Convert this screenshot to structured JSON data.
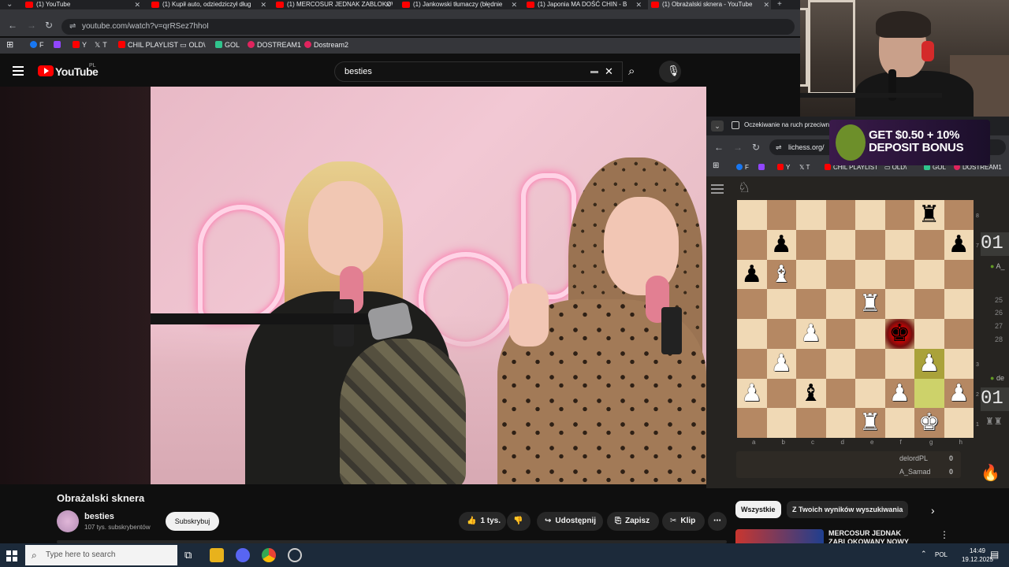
{
  "tabs": [
    {
      "title": "(1) YouTube"
    },
    {
      "title": "(1) Kupił auto, odziedziczył dług"
    },
    {
      "title": "(1) MERCOSUR JEDNAK ZABLOKOWANY"
    },
    {
      "title": "(1) Jankowski tłumaczy (błędnie"
    },
    {
      "title": "(1) Japonia MA DOŚĆ CHIN - B"
    },
    {
      "title": "(1) Obrażalski sknera - YouTube"
    }
  ],
  "address": {
    "url": "youtube.com/watch?v=qrRSez7hhoI"
  },
  "bookmarks": [
    {
      "label": "F",
      "color": "#1877f2"
    },
    {
      "label": "",
      "color": "#9146ff"
    },
    {
      "label": "Y",
      "color": "#ff0000"
    },
    {
      "label": "T",
      "color": "#ffffff"
    },
    {
      "label": "CHIL PLAYLIST",
      "color": "#ff0000"
    },
    {
      "label": "OLD\\",
      "color": "#bdc1c6"
    },
    {
      "label": "GOL",
      "color": "#30c48d"
    },
    {
      "label": "DOSTREAM1",
      "color": "#e0245e"
    },
    {
      "label": "Dostream2",
      "color": "#e0245e"
    }
  ],
  "youtube": {
    "logo_text": "YouTube",
    "region": "PL",
    "search_value": "besties",
    "video_title": "Obrażalski sknera",
    "channel_name": "besties",
    "channel_subs": "107 tys. subskrybentów",
    "subscribe_label": "Subskrybuj",
    "like_count": "1 tys.",
    "share_label": "Udostępnij",
    "save_label": "Zapisz",
    "clip_label": "Klip",
    "video_neon_text": "besties"
  },
  "lichess": {
    "window_title": "Oczekiwanie na ruch przeciwn",
    "url": "lichess.org/",
    "bookmarks": [
      "F",
      "",
      "Y",
      "T",
      "CHIL PLAYLIST",
      "OLD\\",
      "GOL",
      "DOSTREAM1"
    ],
    "ad_text_line1": "GET $0.50 + 10%",
    "ad_text_line2": "DEPOSIT BONUS",
    "files": [
      "a",
      "b",
      "c",
      "d",
      "e",
      "f",
      "g",
      "h"
    ],
    "ranks": [
      "8",
      "7",
      "3",
      "2",
      "1"
    ],
    "players": [
      {
        "name": "delordPL",
        "score": "0"
      },
      {
        "name": "A_Samad",
        "score": "0"
      }
    ],
    "clock_top": "01",
    "clock_bottom": "01",
    "side_user_top": "A_",
    "side_user_bottom": "de",
    "move_numbers": [
      "25",
      "26",
      "27",
      "28"
    ],
    "board": [
      [
        "",
        "",
        "",
        "",
        "",
        "",
        "bR",
        ""
      ],
      [
        "",
        "bP",
        "",
        "",
        "",
        "",
        "",
        "bP"
      ],
      [
        "bP",
        "wB",
        "",
        "",
        "",
        "",
        "",
        ""
      ],
      [
        "",
        "",
        "",
        "",
        "wR",
        "",
        "",
        ""
      ],
      [
        "",
        "",
        "wP",
        "",
        "",
        "bK",
        "",
        ""
      ],
      [
        "",
        "wP",
        "",
        "",
        "",
        "",
        "wP",
        ""
      ],
      [
        "wP",
        "",
        "bB",
        "",
        "",
        "wP",
        "",
        "wP"
      ],
      [
        "",
        "",
        "",
        "",
        "wR",
        "",
        "wK",
        ""
      ]
    ]
  },
  "recommendations": {
    "chips": [
      "Wszystkie",
      "Z Twoich wyników wyszukiwania"
    ],
    "item_title": "MERCOSUR JEDNAK ZABLOKOWANY NOWY"
  },
  "taskbar": {
    "search_placeholder": "Type here to search",
    "time": "14:49",
    "date": "19.12.2025",
    "lang": "POL"
  }
}
